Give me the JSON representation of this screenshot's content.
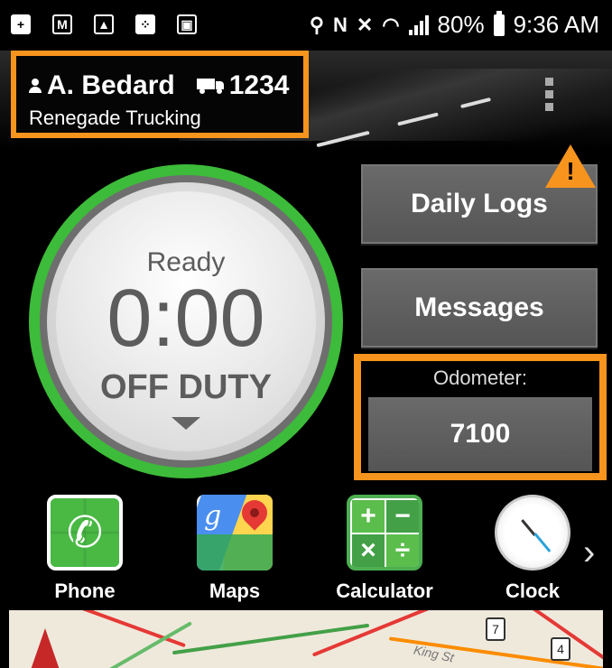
{
  "status_bar": {
    "left_icons": [
      "add-icon",
      "gmail-icon",
      "image-icon",
      "bbm-icon",
      "device-icon"
    ],
    "battery_percent": "80%",
    "time": "9:36 AM",
    "nfc_label": "N"
  },
  "header": {
    "driver_name": "A. Bedard",
    "truck_number": "1234",
    "company": "Renegade Trucking"
  },
  "duty": {
    "state_label": "Ready",
    "time": "0:00",
    "status": "OFF DUTY"
  },
  "buttons": {
    "daily_logs": "Daily Logs",
    "messages": "Messages"
  },
  "odometer": {
    "label": "Odometer:",
    "value": "7100"
  },
  "dock": {
    "apps": [
      {
        "label": "Phone",
        "icon": "phone-icon"
      },
      {
        "label": "Maps",
        "icon": "maps-icon"
      },
      {
        "label": "Calculator",
        "icon": "calculator-icon"
      },
      {
        "label": "Clock",
        "icon": "clock-icon"
      }
    ],
    "map_glyph": "g",
    "calc_glyphs": [
      "+",
      "−",
      "×",
      "÷"
    ]
  },
  "map": {
    "shield_1": "7",
    "shield_2": "4",
    "street_label": "King St"
  },
  "colors": {
    "highlight": "#f7941d",
    "duty_ring": "#3dbb3a",
    "button": "#5f5f5f"
  }
}
